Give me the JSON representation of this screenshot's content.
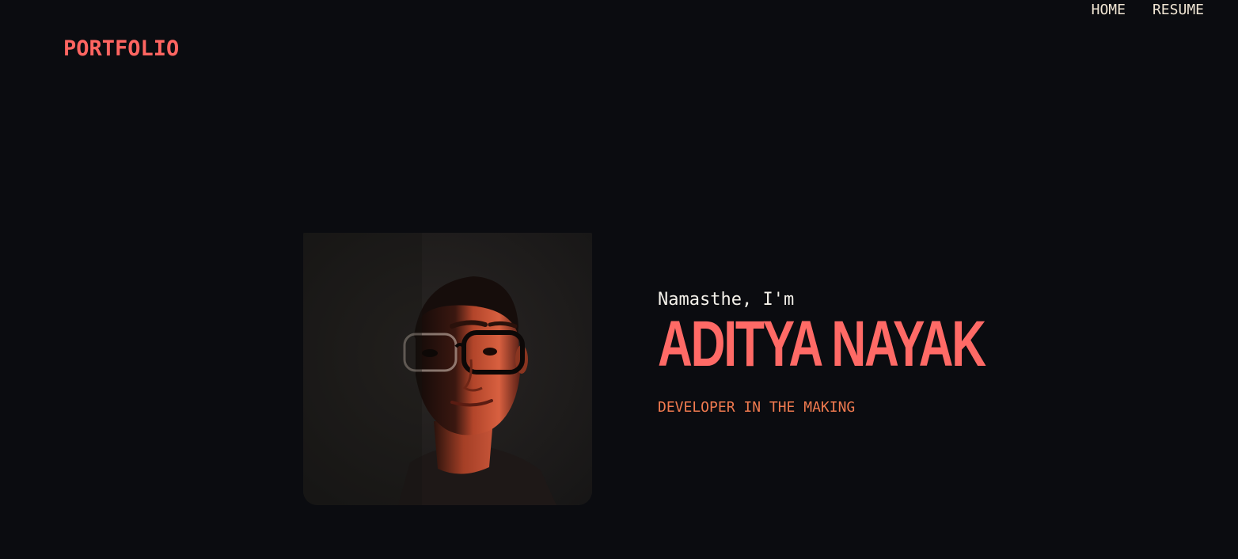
{
  "header": {
    "logo": "PORTFOLIO",
    "nav": [
      {
        "label": "HOME"
      },
      {
        "label": "RESUME"
      }
    ]
  },
  "hero": {
    "greeting": "Namasthe, I'm",
    "name": "ADITYA NAYAK",
    "tagline": "DEVELOPER IN THE MAKING",
    "photo_icon": "profile-photo"
  },
  "colors": {
    "background": "#0b0c10",
    "accent": "#ff6561",
    "tagline": "#f07a4f",
    "nav_text": "#f1e6d4"
  }
}
